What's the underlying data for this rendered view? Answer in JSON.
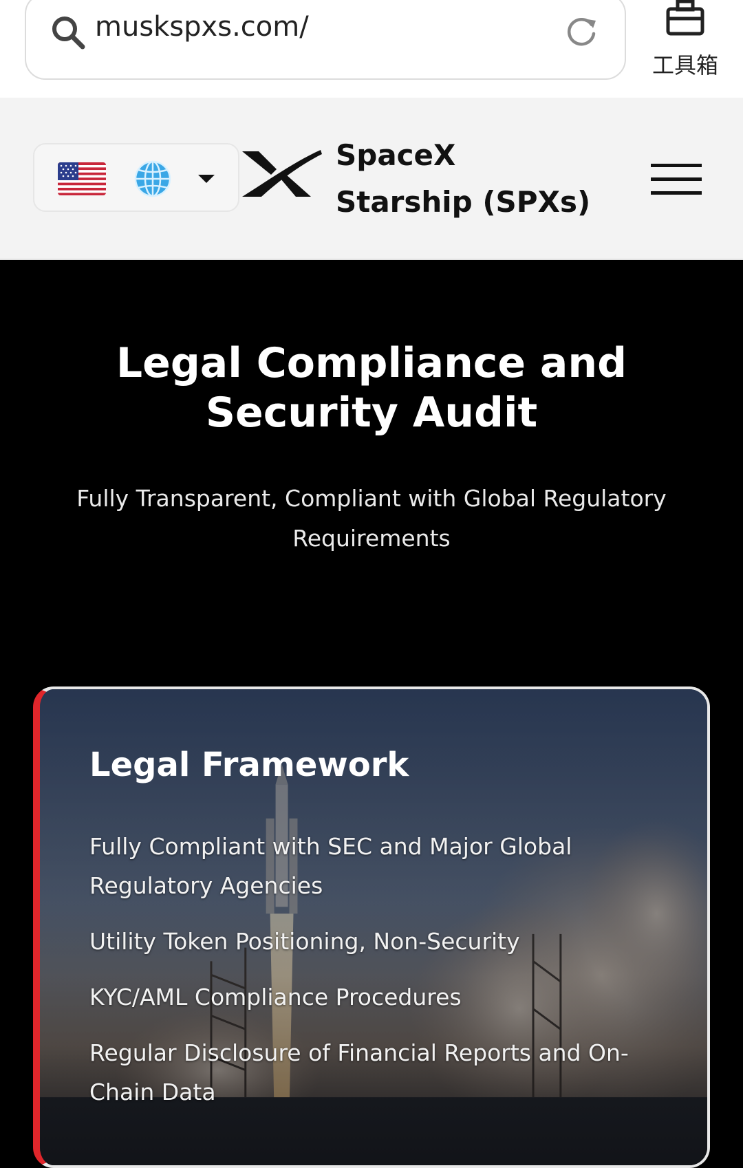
{
  "browser": {
    "url": "muskspxs.com/",
    "toolbox_label": "工具箱"
  },
  "header": {
    "brand_name": "SpaceX Starship (SPXs)",
    "language": {
      "flag": "us-flag-icon",
      "globe": "globe-icon"
    }
  },
  "hero": {
    "title": "Legal Compliance and Security Audit",
    "subtitle": "Fully Transparent, Compliant with Global Regulatory Requirements"
  },
  "card": {
    "title": "Legal Framework",
    "items": [
      "Fully Compliant with SEC and Major Global Regulatory Agencies",
      "Utility Token Positioning, Non-Security",
      "KYC/AML Compliance Procedures",
      "Regular Disclosure of Financial Reports and On-Chain Data"
    ]
  },
  "colors": {
    "accent_red": "#e0262b",
    "header_bg": "#f3f3f3",
    "hero_bg": "#000000"
  }
}
